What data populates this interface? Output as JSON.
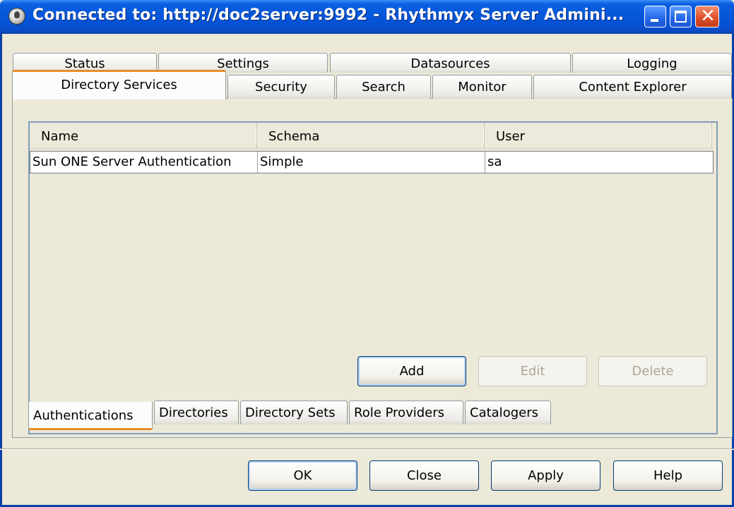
{
  "window": {
    "title": "Connected to: http://doc2server:9992 - Rhythmyx Server Admini...",
    "close_glyph": "✕"
  },
  "main_tabs": {
    "row1": [
      "Status",
      "Settings",
      "Datasources",
      "Logging"
    ],
    "row2": [
      "Directory Services",
      "Security",
      "Search",
      "Monitor",
      "Content Explorer"
    ],
    "active": "Directory Services"
  },
  "table": {
    "columns": [
      "Name",
      "Schema",
      "User"
    ],
    "rows": [
      [
        "Sun ONE Server Authentication",
        "Simple",
        "sa"
      ]
    ]
  },
  "table_buttons": {
    "add": "Add",
    "edit": "Edit",
    "delete": "Delete"
  },
  "sub_tabs": {
    "items": [
      "Authentications",
      "Directories",
      "Directory Sets",
      "Role Providers",
      "Catalogers"
    ],
    "active": "Authentications"
  },
  "dialog_buttons": {
    "ok": "OK",
    "close": "Close",
    "apply": "Apply",
    "help": "Help"
  },
  "colors": {
    "titlebar": "#0454d8",
    "tab_highlight": "#e68b2c",
    "window_bg": "#ece9d8"
  }
}
